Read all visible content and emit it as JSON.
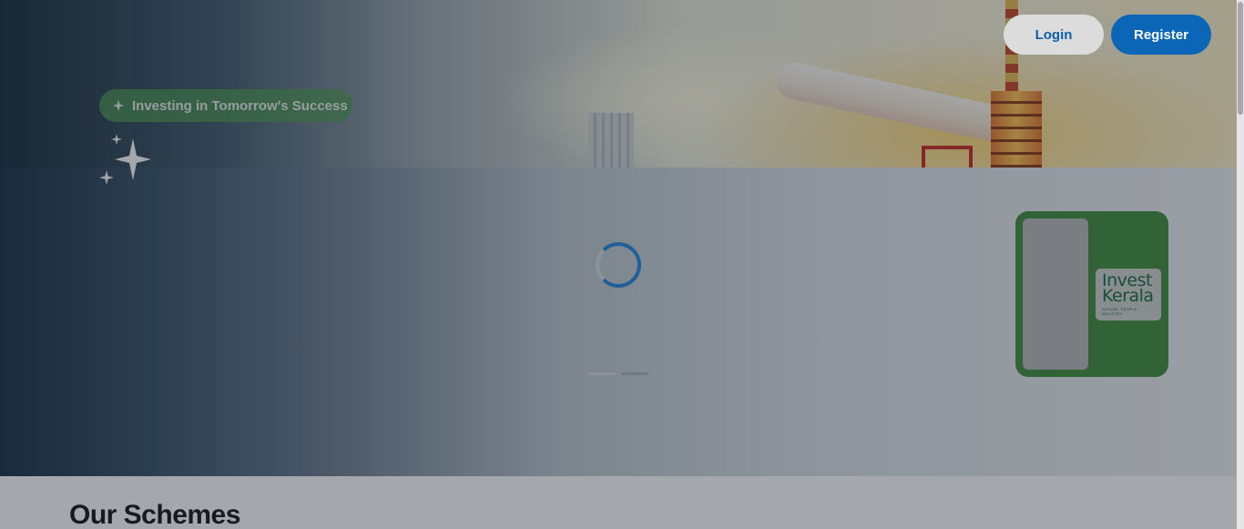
{
  "header": {
    "login_label": "Login",
    "register_label": "Register"
  },
  "hero": {
    "tagline": "Investing in Tomorrow's Success",
    "tagline_icon": "sparkle-icon",
    "decor_icon": "sparkles-icon",
    "loading_indicator": "spinner",
    "carousel": {
      "slide_count": 2,
      "active_index": 0
    }
  },
  "brand_card": {
    "logo_line1": "Invest",
    "logo_line2": "Kerala",
    "logo_tagline": "NATURE. PEOPLE. INDUSTRY."
  },
  "schemes": {
    "title": "Our Schemes"
  },
  "colors": {
    "primary_blue": "#0b66b8",
    "login_text": "#0d5fa8",
    "brand_green": "#398a36",
    "pill_green": "#489650",
    "spinner_blue": "#1c84dd"
  }
}
